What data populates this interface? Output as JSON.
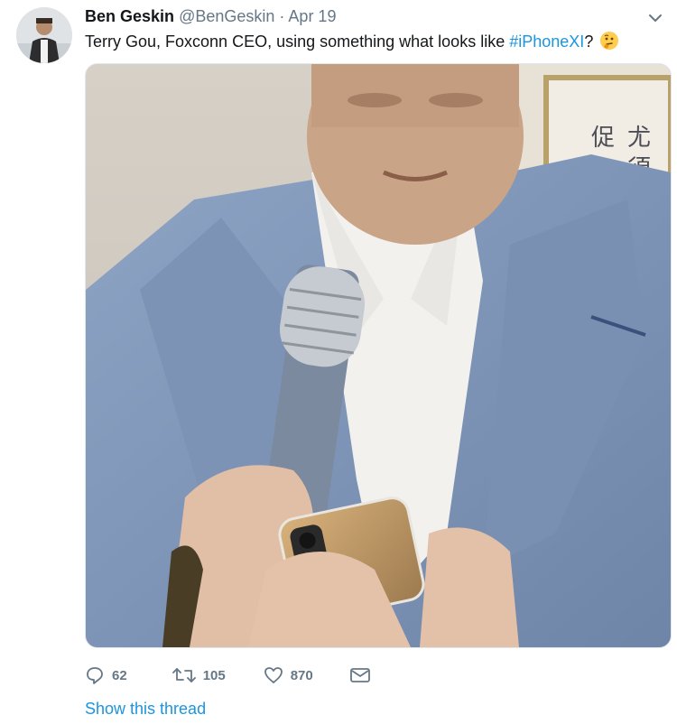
{
  "tweet": {
    "author_name": "Ben Geskin",
    "author_handle": "@BenGeskin",
    "separator": "·",
    "date": "Apr 19",
    "text_before": "Terry Gou, Foxconn CEO, using something what looks like",
    "hashtag": "#iPhoneXI",
    "text_after": "?",
    "emoji": "thinking-face-emoji",
    "media_description": "photo-of-man-in-blue-suit-holding-microphone-and-phone"
  },
  "actions": {
    "replies": "62",
    "retweets": "105",
    "likes": "870"
  },
  "show_thread": "Show this thread",
  "colors": {
    "link": "#1b95e0",
    "muted": "#657786",
    "text": "#14171a"
  }
}
